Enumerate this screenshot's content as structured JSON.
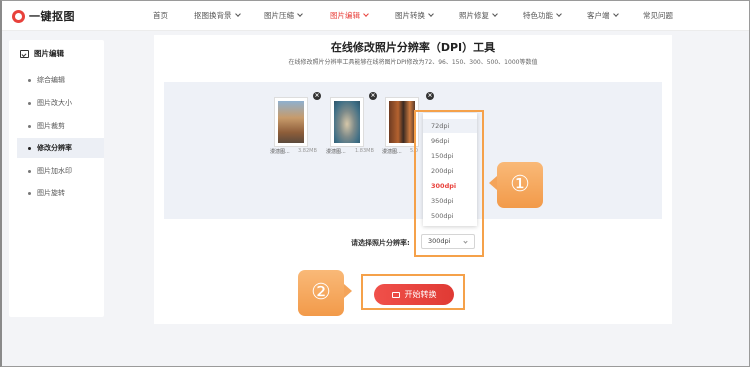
{
  "header": {
    "logo_text": "一键抠图",
    "nav": [
      {
        "label": "首页",
        "has_caret": false
      },
      {
        "label": "抠图换背景",
        "has_caret": true
      },
      {
        "label": "图片压缩",
        "has_caret": true
      },
      {
        "label": "图片编辑",
        "has_caret": true,
        "active": true
      },
      {
        "label": "图片转换",
        "has_caret": true
      },
      {
        "label": "照片修复",
        "has_caret": true
      },
      {
        "label": "特色功能",
        "has_caret": true
      },
      {
        "label": "客户端",
        "has_caret": true
      },
      {
        "label": "常见问题",
        "has_caret": false
      }
    ]
  },
  "sidebar": {
    "title": "图片编辑",
    "items": [
      {
        "label": "综合编辑"
      },
      {
        "label": "图片改大小"
      },
      {
        "label": "图片裁剪"
      },
      {
        "label": "修改分辨率",
        "active": true
      },
      {
        "label": "图片加水印"
      },
      {
        "label": "图片旋转"
      }
    ]
  },
  "main": {
    "title": "在线修改照片分辨率（DPI）工具",
    "subtitle": "在线修改照片分辨率工具能够在线将图片DPI修改为72、96、150、300、500、1000等数值",
    "files": [
      {
        "name": "漫漶图...",
        "size": "3.82MB"
      },
      {
        "name": "漫漶图...",
        "size": "1.83MB"
      },
      {
        "name": "漫漶图...",
        "size": "5.0"
      }
    ],
    "dropdown_options": [
      "72dpi",
      "96dpi",
      "150dpi",
      "200dpi",
      "300dpi",
      "350dpi",
      "500dpi"
    ],
    "dropdown_selected": "300dpi",
    "resolution_label": "请选择照片分辨率:",
    "resolution_value": "300dpi",
    "convert_button": "开始转换"
  },
  "annotations": {
    "step1": "①",
    "step2": "②"
  },
  "colors": {
    "accent": "#e8413b",
    "annotation": "#f5a14a"
  }
}
